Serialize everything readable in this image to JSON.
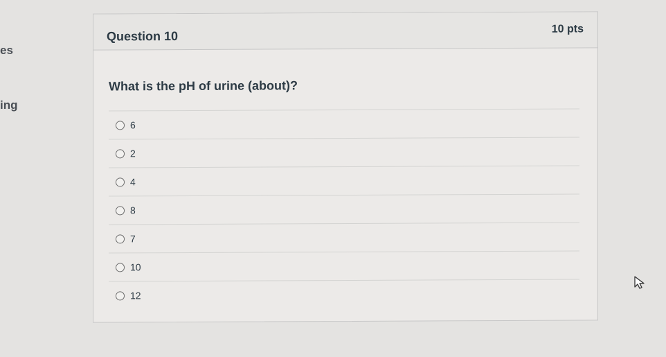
{
  "sidebar": {
    "fragment_1": "es",
    "fragment_2": "ing"
  },
  "question": {
    "title": "Question 10",
    "points": "10 pts",
    "text": "What is the pH of urine (about)?",
    "answers": [
      "6",
      "2",
      "4",
      "8",
      "7",
      "10",
      "12"
    ]
  },
  "icons": {
    "cursor": "mouse-pointer-icon",
    "radio": "radio-unchecked-icon"
  },
  "colors": {
    "text": "#2d3b45",
    "card_bg": "#eceae8",
    "border": "#c7c7c7"
  }
}
